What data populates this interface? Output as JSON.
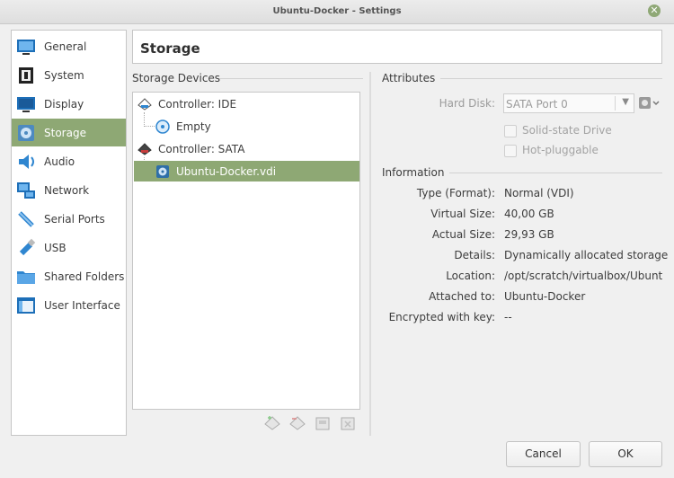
{
  "window": {
    "title": "Ubuntu-Docker - Settings"
  },
  "sidebar": {
    "items": [
      {
        "label": "General",
        "icon": "general-icon"
      },
      {
        "label": "System",
        "icon": "chip-icon"
      },
      {
        "label": "Display",
        "icon": "monitor-icon"
      },
      {
        "label": "Storage",
        "icon": "disk-icon",
        "selected": true
      },
      {
        "label": "Audio",
        "icon": "speaker-icon"
      },
      {
        "label": "Network",
        "icon": "network-icon"
      },
      {
        "label": "Serial Ports",
        "icon": "serial-port-icon"
      },
      {
        "label": "USB",
        "icon": "usb-icon"
      },
      {
        "label": "Shared Folders",
        "icon": "folder-icon"
      },
      {
        "label": "User Interface",
        "icon": "window-icon"
      }
    ]
  },
  "page": {
    "title": "Storage"
  },
  "storage_devices": {
    "title": "Storage Devices",
    "tree": [
      {
        "label": "Controller: IDE",
        "icon": "ide-controller-icon"
      },
      {
        "label": "Empty",
        "icon": "optical-disc-icon"
      },
      {
        "label": "Controller: SATA",
        "icon": "sata-controller-icon"
      },
      {
        "label": "Ubuntu-Docker.vdi",
        "icon": "hard-disk-icon",
        "selected": true
      }
    ]
  },
  "attributes": {
    "title": "Attributes",
    "hard_disk_label": "Hard Disk:",
    "hard_disk_value": "SATA Port 0",
    "solid_state_label": "Solid-state Drive",
    "hot_pluggable_label": "Hot-pluggable"
  },
  "information": {
    "title": "Information",
    "rows": [
      {
        "label": "Type (Format):",
        "value": "Normal (VDI)"
      },
      {
        "label": "Virtual Size:",
        "value": "40,00 GB"
      },
      {
        "label": "Actual Size:",
        "value": "29,93 GB"
      },
      {
        "label": "Details:",
        "value": "Dynamically allocated storage"
      },
      {
        "label": "Location:",
        "value": "/opt/scratch/virtualbox/Ubunt..."
      },
      {
        "label": "Attached to:",
        "value": "Ubuntu-Docker"
      },
      {
        "label": "Encrypted with key:",
        "value": "--"
      }
    ]
  },
  "buttons": {
    "cancel": "Cancel",
    "ok": "OK"
  },
  "colors": {
    "selection": "#8ea874",
    "accent_blue": "#2d7fc4"
  }
}
